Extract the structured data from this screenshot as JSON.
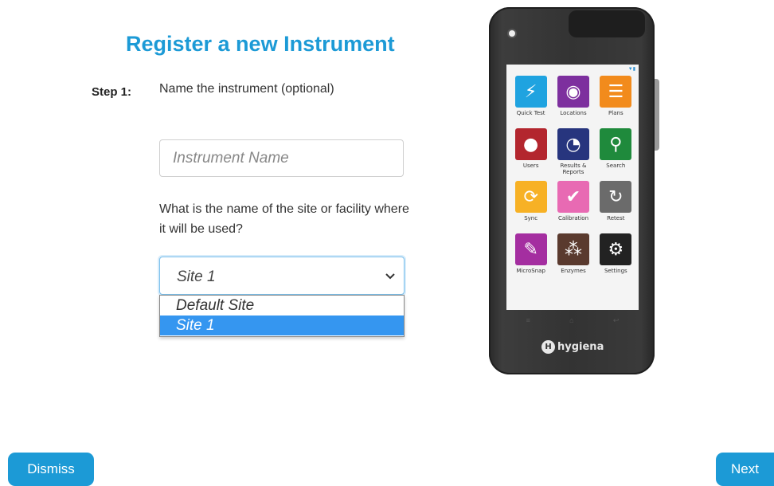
{
  "header": {
    "title": "Register a new Instrument"
  },
  "step": {
    "label": "Step 1:",
    "instruction": "Name the instrument (optional)"
  },
  "instrument_name": {
    "placeholder": "Instrument Name",
    "value": ""
  },
  "site": {
    "question": "What is the name of the site or facility where it will be used?",
    "selected": "Site 1",
    "options": [
      "Default Site",
      "Site 1"
    ]
  },
  "device": {
    "brand": "hygiena",
    "apps": [
      {
        "label": "Quick Test",
        "icon": "lightning-icon",
        "color": "#1fa3e0"
      },
      {
        "label": "Locations",
        "icon": "location-pin-icon",
        "color": "#7d2f9e"
      },
      {
        "label": "Plans",
        "icon": "list-icon",
        "color": "#f28b1c"
      },
      {
        "label": "Users",
        "icon": "user-icon",
        "color": "#b3262e"
      },
      {
        "label": "Results & Reports",
        "icon": "pie-chart-icon",
        "color": "#27357e"
      },
      {
        "label": "Search",
        "icon": "search-icon",
        "color": "#1f8a3c"
      },
      {
        "label": "Sync",
        "icon": "sync-icon",
        "color": "#f7b125"
      },
      {
        "label": "Calibration",
        "icon": "checkmark-icon",
        "color": "#e86ab3"
      },
      {
        "label": "Retest",
        "icon": "retest-icon",
        "color": "#6b6b6b"
      },
      {
        "label": "MicroSnap",
        "icon": "swab-icon",
        "color": "#a42ea0"
      },
      {
        "label": "Enzymes",
        "icon": "molecule-icon",
        "color": "#5a3a2e"
      },
      {
        "label": "Settings",
        "icon": "gear-icon",
        "color": "#222222"
      }
    ]
  },
  "buttons": {
    "dismiss": "Dismiss",
    "next": "Next"
  },
  "colors": {
    "accent": "#1c9ad6",
    "selected_option": "#3596f0"
  }
}
